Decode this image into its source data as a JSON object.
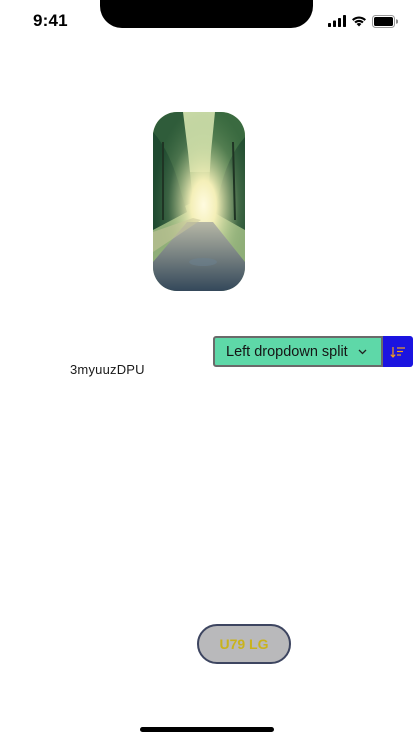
{
  "status_bar": {
    "time": "9:41"
  },
  "photo": {
    "icon": "landscape-photo"
  },
  "dropdown": {
    "label": "Left dropdown split",
    "chevron_icon": "chevron-down-icon",
    "side_icon": "sort-descending-icon",
    "main_color": "#5ed8a8",
    "side_color": "#1b14e0"
  },
  "label_text": "3myuuzDPU",
  "pill_button": {
    "label": "U79 LG",
    "background": "#b9b9bb",
    "text_color": "#c9b31c"
  }
}
